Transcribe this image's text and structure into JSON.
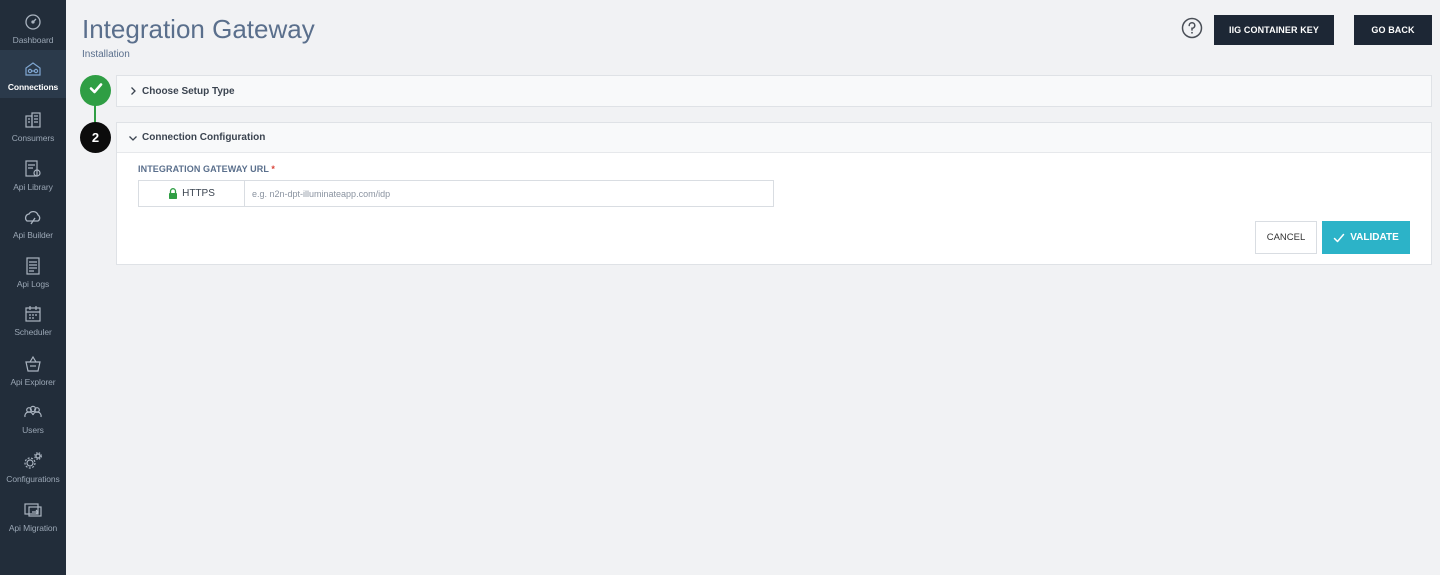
{
  "sidebar": {
    "items": [
      {
        "label": "Dashboard",
        "icon": "dashboard-icon",
        "active": false
      },
      {
        "label": "Connections",
        "icon": "connections-icon",
        "active": true
      },
      {
        "label": "Consumers",
        "icon": "consumers-icon",
        "active": false
      },
      {
        "label": "Api Library",
        "icon": "api-library-icon",
        "active": false
      },
      {
        "label": "Api Builder",
        "icon": "api-builder-icon",
        "active": false
      },
      {
        "label": "Api Logs",
        "icon": "api-logs-icon",
        "active": false
      },
      {
        "label": "Scheduler",
        "icon": "scheduler-icon",
        "active": false
      },
      {
        "label": "Api Explorer",
        "icon": "api-explorer-icon",
        "active": false
      },
      {
        "label": "Users",
        "icon": "users-icon",
        "active": false
      },
      {
        "label": "Configurations",
        "icon": "configurations-icon",
        "active": false
      },
      {
        "label": "Api Migration",
        "icon": "api-migration-icon",
        "active": false
      }
    ]
  },
  "header": {
    "title": "Integration Gateway",
    "subtitle": "Installation",
    "iig_button": "IIG CONTAINER KEY",
    "back_button": "GO BACK"
  },
  "steps": {
    "step1": {
      "title": "Choose Setup Type",
      "status": "complete"
    },
    "step2": {
      "number": "2",
      "title": "Connection Configuration"
    }
  },
  "form": {
    "url_label": "INTEGRATION GATEWAY URL",
    "required_mark": "*",
    "protocol": "HTTPS",
    "url_value": "",
    "url_placeholder": "e.g. n2n-dpt-illuminateapp.com/idp",
    "cancel": "CANCEL",
    "validate": "VALIDATE"
  },
  "colors": {
    "sidebar_bg": "#222d3a",
    "accent_teal": "#2cb3c8",
    "success_green": "#2f9e44",
    "title_blue": "#5a6f8c",
    "dark_button": "#1d2735"
  }
}
